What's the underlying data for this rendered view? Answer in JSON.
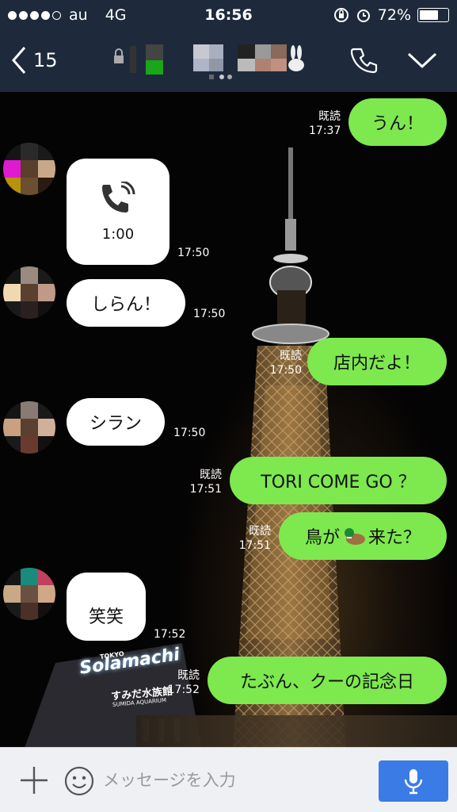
{
  "status_bar": {
    "carrier": "au",
    "network": "4G",
    "time": "16:56",
    "battery_percent": "72%",
    "battery_level": 0.72
  },
  "header": {
    "back_count": "15",
    "back_icon": "chevron-left-icon",
    "call_icon": "phone-icon",
    "menu_icon": "chevron-down-icon"
  },
  "messages": [
    {
      "side": "right",
      "text": "うん！",
      "read": "既読",
      "time": "17:37"
    },
    {
      "side": "left",
      "type": "call",
      "duration": "1:00",
      "time": "17:50"
    },
    {
      "side": "left",
      "text": "しらん！",
      "time": "17:50"
    },
    {
      "side": "right",
      "text": "店内だよ！",
      "read": "既読",
      "time": "17:50"
    },
    {
      "side": "left",
      "text": "シラン",
      "time": "17:50"
    },
    {
      "side": "right",
      "text": "TORI COME GO ？",
      "read": "既読",
      "time": "17:51"
    },
    {
      "side": "right",
      "text_before": "鳥が",
      "emoji": "duck-emoji",
      "text_after": "来た？",
      "read": "既読",
      "time": "17:51"
    },
    {
      "side": "left",
      "text": "笑笑",
      "time": "17:52"
    },
    {
      "side": "right",
      "text": "たぶん、クーの記念日",
      "read": "既読",
      "time": "17:52"
    }
  ],
  "background_signs": {
    "solamachi_small": "TOKYO",
    "solamachi": "Solamachi",
    "aquarium_jp": "すみだ水族館",
    "aquarium_en": "SUMIDA AQUARIUM"
  },
  "input": {
    "placeholder": "メッセージを入力",
    "value": ""
  },
  "colors": {
    "header_bg": "#1e2a3c",
    "outgoing_bubble": "#7ee84f",
    "incoming_bubble": "#ffffff",
    "mic_button": "#3b7be6"
  }
}
